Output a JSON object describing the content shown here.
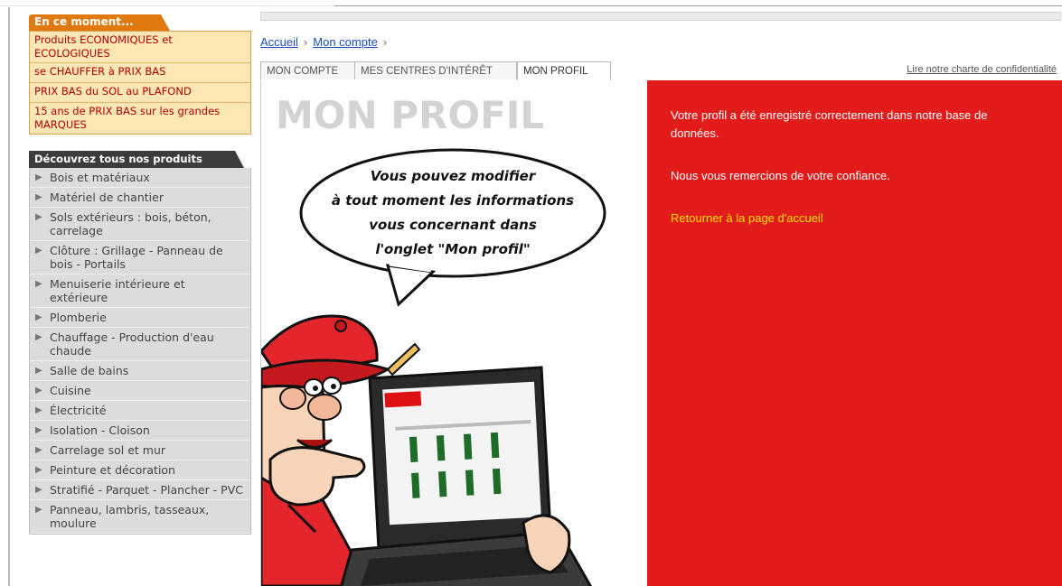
{
  "sidebar": {
    "promo_header": "En ce moment...",
    "promos": [
      "Produits ECONOMIQUES et ECOLOGIQUES",
      "se CHAUFFER à PRIX BAS",
      "PRIX BAS du SOL au PLAFOND",
      "15 ans de PRIX BAS sur les grandes MARQUES"
    ],
    "categories_header": "Découvrez tous nos produits",
    "categories": [
      "Bois et matériaux",
      "Matériel de chantier",
      "Sols extérieurs : bois, béton, carrelage",
      "Clôture : Grillage - Panneau de bois - Portails",
      "Menuiserie intérieure et extérieure",
      "Plomberie",
      "Chauffage - Production d'eau chaude",
      "Salle de bains",
      "Cuisine",
      "Électricité",
      "Isolation - Cloison",
      "Carrelage sol et mur",
      "Peinture et décoration",
      "Stratifié - Parquet - Plancher - PVC",
      "Panneau, lambris, tasseaux, moulure"
    ]
  },
  "breadcrumb": {
    "home": "Accueil",
    "account": "Mon compte"
  },
  "tabs": {
    "account": "MON COMPTE",
    "interests": "MES CENTRES D'INTÉRÊT",
    "profile": "MON PROFIL"
  },
  "privacy_link": "Lire notre charte de confidentialité",
  "page_title": "MON PROFIL",
  "bubble": {
    "line1": "Vous pouvez modifier",
    "line2": "à tout moment les informations",
    "line3": "vous concernant dans",
    "line4": "l'onglet \"Mon profil\""
  },
  "messages": {
    "saved": "Votre profil a été enregistré correctement dans notre base de données.",
    "thanks": "Nous vous remercions de votre confiance.",
    "home_link": "Retourner à la page d'accueil"
  },
  "colors": {
    "accent_red": "#e21b1b",
    "promo_orange": "#e07a10",
    "link_yellow": "#ffe000",
    "link_blue": "#1a4bbf"
  }
}
